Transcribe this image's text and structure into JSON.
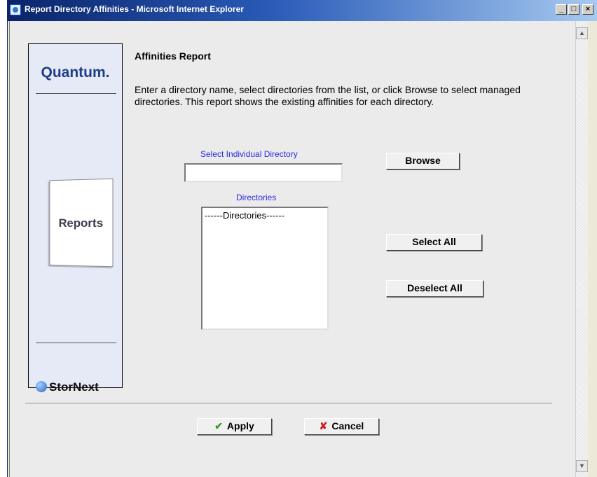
{
  "window": {
    "title": "Report Directory Affinities - Microsoft Internet Explorer",
    "controls": {
      "minimize": "_",
      "maximize": "□",
      "close": "×"
    }
  },
  "brand": {
    "logo_text": "Quantum.",
    "section_label": "Reports",
    "product_name": "StorNext"
  },
  "content": {
    "heading": "Affinities Report",
    "description": "Enter a directory name, select directories from the list, or click Browse to select managed directories. This report shows the existing affinities for each directory.",
    "select_label": "Select Individual Directory",
    "select_value": "",
    "directories_label": "Directories",
    "directories_options": [
      "------Directories------"
    ]
  },
  "buttons": {
    "browse": "Browse",
    "select_all": "Select All",
    "deselect_all": "Deselect All",
    "apply": "Apply",
    "cancel": "Cancel"
  },
  "icons": {
    "apply": "checkmark-icon",
    "cancel": "x-icon",
    "title": "ie-page-icon",
    "brand": "globe-icon"
  },
  "colors": {
    "titlebar_start": "#0a246a",
    "label_blue": "#2b2be0",
    "brand_navy": "#1e3f86",
    "apply_green": "#2e9a2e",
    "cancel_red": "#d01a1a"
  }
}
